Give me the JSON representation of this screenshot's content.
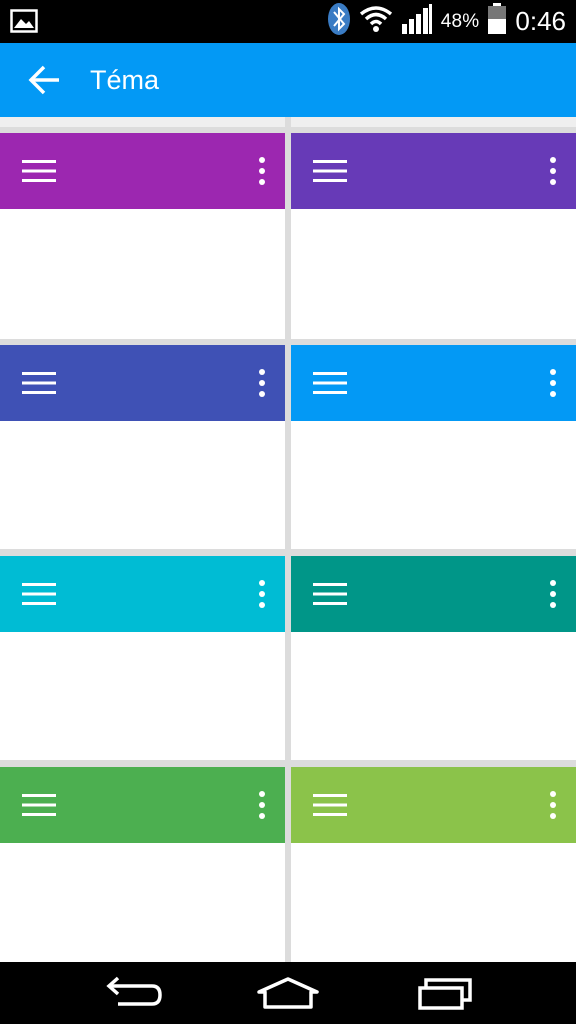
{
  "status_bar": {
    "battery_percent": "48%",
    "time": "0:46",
    "icons": [
      "image-icon",
      "bluetooth-icon",
      "wifi-icon",
      "signal-icon",
      "battery-icon"
    ]
  },
  "app_bar": {
    "title": "Téma",
    "back_icon": "arrow-back-icon"
  },
  "themes": [
    {
      "color": "#9c27b0"
    },
    {
      "color": "#673ab7"
    },
    {
      "color": "#3f51b5"
    },
    {
      "color": "#0399f5"
    },
    {
      "color": "#00bcd4"
    },
    {
      "color": "#009688"
    },
    {
      "color": "#4caf50"
    },
    {
      "color": "#8bc34a"
    }
  ],
  "nav_bar": {
    "icons": [
      "back-icon",
      "home-icon",
      "recents-icon"
    ]
  }
}
